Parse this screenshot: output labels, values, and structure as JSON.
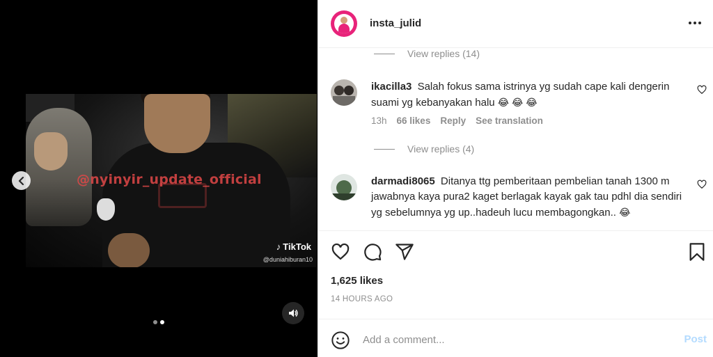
{
  "post": {
    "account": "insta_julid",
    "likes": "1,625 likes",
    "time_ago": "14 HOURS AGO"
  },
  "media": {
    "watermark_text": "@nyinyir_update_official",
    "tiktok_label": "TikTok",
    "tiktok_handle": "@duniahiburan10",
    "carousel_dots": 2,
    "carousel_active": 2
  },
  "comments": {
    "replies_top": "View replies (14)",
    "items": [
      {
        "username": "ikacilla3",
        "text": "Salah fokus sama istrinya yg sudah cape kali dengerin suami yg kebanyakan halu",
        "emoji": "😂 😂 😂",
        "age": "13h",
        "likes": "66 likes",
        "reply": "Reply",
        "translate": "See translation",
        "replies": "View replies (4)"
      },
      {
        "username": "darmadi8065",
        "text": "Ditanya ttg pemberitaan pembelian tanah 1300 m jawabnya kaya pura2 kaget berlagak kayak gak tau pdhl dia sendiri yg sebelumnya yg up..hadeuh lucu membagongkan..",
        "emoji": "😂"
      }
    ]
  },
  "composer": {
    "placeholder": "Add a comment...",
    "post_label": "Post"
  },
  "colors": {
    "accent_ring": "#e8237a",
    "post_disabled": "#b3dbff",
    "muted": "#8e8e8e"
  },
  "icons": [
    "chevron-left-icon",
    "sound-icon",
    "more-icon",
    "heart-icon",
    "comment-icon",
    "share-icon",
    "bookmark-icon",
    "emoji-icon"
  ]
}
